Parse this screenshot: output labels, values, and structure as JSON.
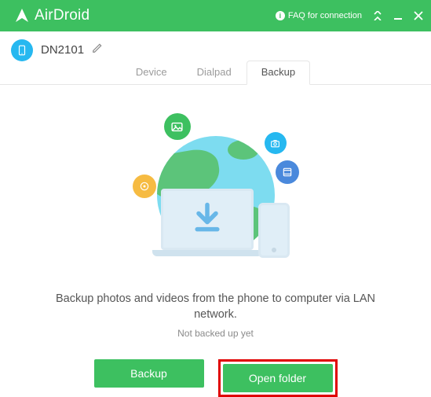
{
  "titlebar": {
    "app_name": "AirDroid",
    "faq_label": "FAQ for connection"
  },
  "device": {
    "name": "DN2101"
  },
  "tabs": [
    {
      "label": "Device",
      "active": false
    },
    {
      "label": "Dialpad",
      "active": false
    },
    {
      "label": "Backup",
      "active": true
    }
  ],
  "main": {
    "description": "Backup photos and videos from the phone to computer via LAN network.",
    "status": "Not backed up yet",
    "backup_button": "Backup",
    "open_folder_button": "Open folder"
  },
  "colors": {
    "accent": "#3dc060",
    "highlight_border": "#e00000"
  }
}
